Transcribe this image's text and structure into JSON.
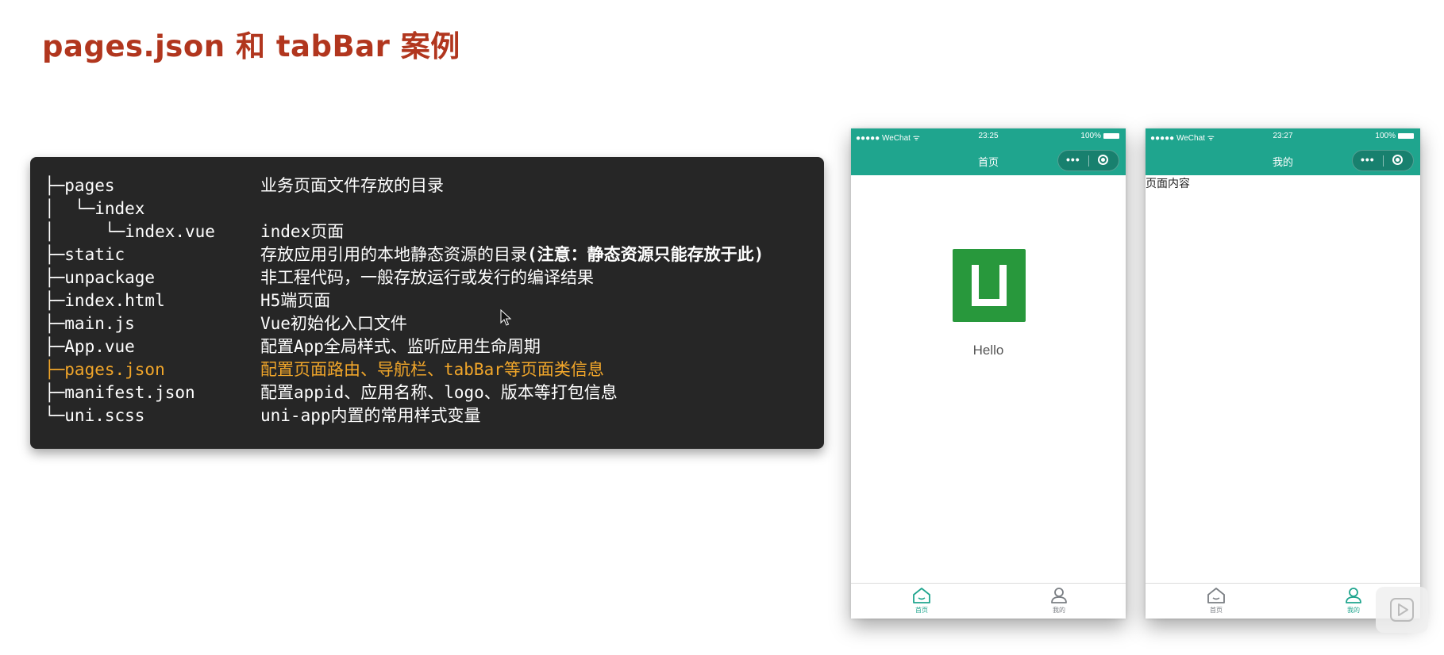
{
  "title": "pages.json 和 tabBar 案例",
  "tree": [
    {
      "name": "├─pages",
      "desc": "业务页面文件存放的目录",
      "highlight": false
    },
    {
      "name": "│  └─index",
      "desc": "",
      "highlight": false
    },
    {
      "name": "│     └─index.vue",
      "desc": "index页面",
      "highlight": false
    },
    {
      "name": "├─static",
      "desc": "存放应用引用的本地静态资源的目录",
      "desc_bold": "(注意：静态资源只能存放于此)",
      "highlight": false
    },
    {
      "name": "├─unpackage",
      "desc": "非工程代码，一般存放运行或发行的编译结果",
      "highlight": false
    },
    {
      "name": "├─index.html",
      "desc": "H5端页面",
      "highlight": false
    },
    {
      "name": "├─main.js",
      "desc": "Vue初始化入口文件",
      "highlight": false
    },
    {
      "name": "├─App.vue",
      "desc": "配置App全局样式、监听应用生命周期",
      "highlight": false
    },
    {
      "name": "├─pages.json",
      "desc": "配置页面路由、导航栏、tabBar等页面类信息",
      "highlight": true
    },
    {
      "name": "├─manifest.json",
      "desc": "配置appid、应用名称、logo、版本等打包信息",
      "highlight": false
    },
    {
      "name": "└─uni.scss",
      "desc": "uni-app内置的常用样式变量",
      "highlight": false
    }
  ],
  "phones": [
    {
      "carrier": "●●●●● WeChat ᯤ",
      "time": "23:25",
      "battery": "100%",
      "nav_title": "首页",
      "body_text": "Hello",
      "tabs": [
        {
          "label": "首页",
          "icon": "home-icon",
          "active": true
        },
        {
          "label": "我的",
          "icon": "user-icon",
          "active": false
        }
      ]
    },
    {
      "carrier": "●●●●● WeChat ᯤ",
      "time": "23:27",
      "battery": "100%",
      "nav_title": "我的",
      "body_text": "页面内容",
      "tabs": [
        {
          "label": "首页",
          "icon": "home-icon",
          "active": false
        },
        {
          "label": "我的",
          "icon": "user-icon",
          "active": true
        }
      ]
    }
  ],
  "colors": {
    "title": "#b1361e",
    "panel_bg": "#262626",
    "highlight": "#f1a62a",
    "theme_green": "#1fa58e",
    "logo_green": "#28983c"
  }
}
